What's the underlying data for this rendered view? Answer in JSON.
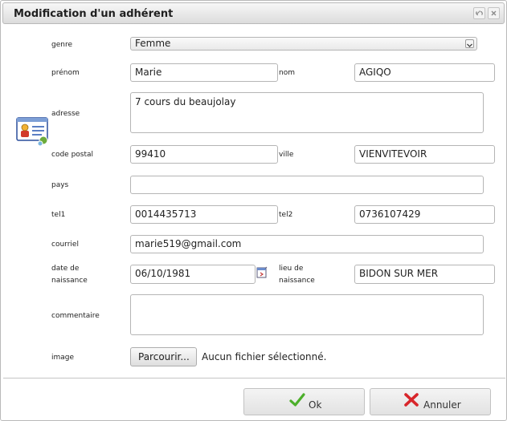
{
  "dialog": {
    "title": "Modification d'un adhérent"
  },
  "icons": {
    "titlebar_restore": "restore-icon",
    "titlebar_close": "close-icon",
    "member_card": "member-card-icon",
    "calendar": "calendar-icon",
    "ok": "check-icon",
    "cancel": "cross-icon"
  },
  "colors": {
    "ok_check": "#4caf2a",
    "cancel_cross": "#d8262b"
  },
  "form": {
    "genre": {
      "label": "genre",
      "value": "Femme"
    },
    "prenom": {
      "label": "prénom",
      "value": "Marie"
    },
    "nom": {
      "label": "nom",
      "value": "AGIQO"
    },
    "adresse": {
      "label": "adresse",
      "value": "7 cours du beaujolay"
    },
    "code_postal": {
      "label": "code postal",
      "value": "99410"
    },
    "ville": {
      "label": "ville",
      "value": "VIENVITEVOIR"
    },
    "pays": {
      "label": "pays",
      "value": ""
    },
    "tel1": {
      "label": "tel1",
      "value": "0014435713"
    },
    "tel2": {
      "label": "tel2",
      "value": "0736107429"
    },
    "courriel": {
      "label": "courriel",
      "value": "marie519@gmail.com"
    },
    "date_naissance": {
      "label_line1": "date de",
      "label_line2": "naissance",
      "value": "06/10/1981"
    },
    "lieu_naissance": {
      "label_line1": "lieu de",
      "label_line2": "naissance",
      "value": "BIDON SUR MER"
    },
    "commentaire": {
      "label": "commentaire",
      "value": ""
    },
    "image": {
      "label": "image",
      "browse_label": "Parcourir...",
      "file_status": "Aucun fichier sélectionné."
    }
  },
  "footer": {
    "ok_label": "Ok",
    "cancel_label": "Annuler"
  }
}
